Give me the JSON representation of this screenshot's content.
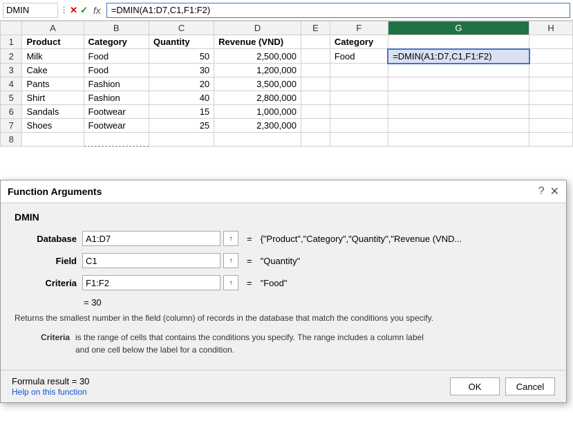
{
  "formulaBar": {
    "nameBox": "DMIN",
    "cancelIcon": "✕",
    "confirmIcon": "✓",
    "fxLabel": "fx",
    "formula": "=DMIN(A1:D7,C1,F1:F2)"
  },
  "spreadsheet": {
    "colHeaders": [
      "",
      "A",
      "B",
      "C",
      "D",
      "E",
      "F",
      "G",
      "H"
    ],
    "rows": [
      {
        "rowNum": "1",
        "cells": [
          "Product",
          "Category",
          "Quantity",
          "Revenue (VND)",
          "",
          "Category",
          "",
          ""
        ]
      },
      {
        "rowNum": "2",
        "cells": [
          "Milk",
          "Food",
          "50",
          "2,500,000",
          "",
          "Food",
          "=DMIN(A1:D7,C1,F1:F2)",
          ""
        ]
      },
      {
        "rowNum": "3",
        "cells": [
          "Cake",
          "Food",
          "30",
          "1,200,000",
          "",
          "",
          "",
          ""
        ]
      },
      {
        "rowNum": "4",
        "cells": [
          "Pants",
          "Fashion",
          "20",
          "3,500,000",
          "",
          "",
          "",
          ""
        ]
      },
      {
        "rowNum": "5",
        "cells": [
          "Shirt",
          "Fashion",
          "40",
          "2,800,000",
          "",
          "",
          "",
          ""
        ]
      },
      {
        "rowNum": "6",
        "cells": [
          "Sandals",
          "Footwear",
          "15",
          "1,000,000",
          "",
          "",
          "",
          ""
        ]
      },
      {
        "rowNum": "7",
        "cells": [
          "Shoes",
          "Footwear",
          "25",
          "2,300,000",
          "",
          "",
          "",
          ""
        ]
      },
      {
        "rowNum": "8",
        "cells": [
          "",
          "",
          "",
          "",
          "",
          "",
          "",
          ""
        ]
      }
    ]
  },
  "dialog": {
    "title": "Function Arguments",
    "helpIcon": "?",
    "closeIcon": "✕",
    "funcName": "DMIN",
    "args": [
      {
        "label": "Database",
        "value": "A1:D7",
        "result": "= {\"Product\",\"Category\",\"Quantity\",\"Revenue (VND..."
      },
      {
        "label": "Field",
        "value": "C1",
        "result": "= \"Quantity\""
      },
      {
        "label": "Criteria",
        "value": "F1:F2",
        "result": "= \"Food\""
      }
    ],
    "resultLine": "=  30",
    "descriptionMain": "Returns the smallest number in the field (column) of records in the database that match the conditions you specify.",
    "criteriaLabel": "Criteria",
    "criteriaDesc": "is the range of cells that contains the conditions you specify. The range includes a column label\nand one cell below the label for a condition.",
    "formulaResult": "Formula result =  30",
    "helpLink": "Help on this function",
    "okLabel": "OK",
    "cancelLabel": "Cancel"
  }
}
